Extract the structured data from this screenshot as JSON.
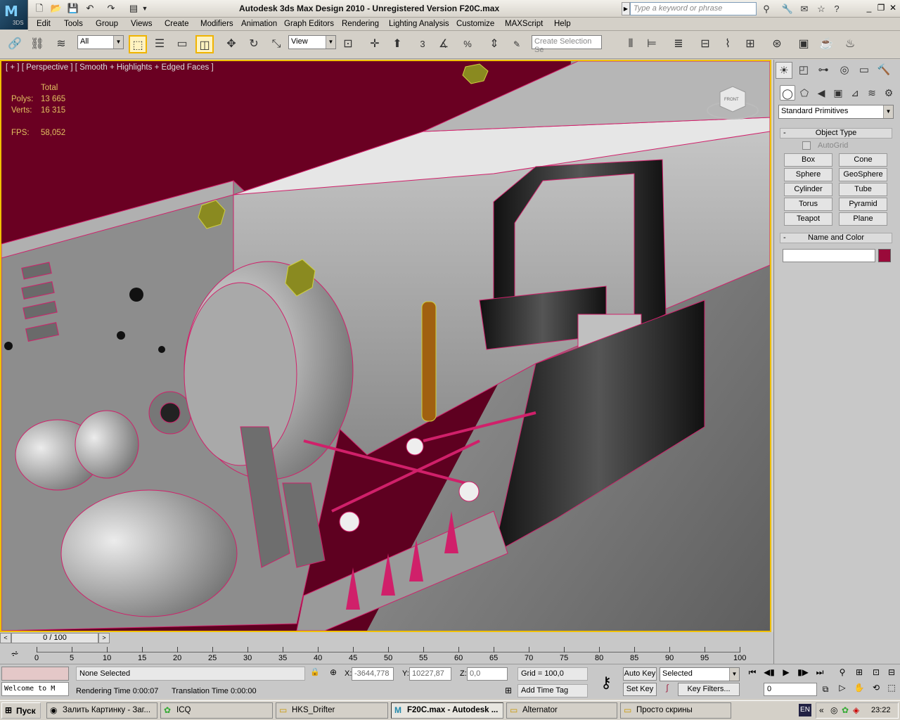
{
  "app": {
    "logo_text": "M",
    "logo_sub": "3DS",
    "title": "Autodesk 3ds Max Design 2010  - Unregistered Version     F20C.max",
    "search_placeholder": "Type a keyword or phrase"
  },
  "menu": [
    "Edit",
    "Tools",
    "Group",
    "Views",
    "Create",
    "Modifiers",
    "Animation",
    "Graph Editors",
    "Rendering",
    "Lighting Analysis",
    "Customize",
    "MAXScript",
    "Help"
  ],
  "toolbar": {
    "selection_filter": "All",
    "reference_coord": "View",
    "named_selection_placeholder": "Create Selection Se",
    "snap_label": "3",
    "angle_snap_label": "%"
  },
  "viewport": {
    "label": "[ + ] [ Perspective ] [ Smooth + Highlights + Edged Faces ]",
    "stats": {
      "total_label": "Total",
      "polys_label": "Polys:",
      "polys_value": "13 665",
      "verts_label": "Verts:",
      "verts_value": "16 315",
      "fps_label": "FPS:",
      "fps_value": "58,052"
    },
    "viewcube_label": "FRONT"
  },
  "command_panel": {
    "category": "Standard Primitives",
    "object_type_title": "Object Type",
    "autogrid_label": "AutoGrid",
    "primitives": [
      "Box",
      "Cone",
      "Sphere",
      "GeoSphere",
      "Cylinder",
      "Tube",
      "Torus",
      "Pyramid",
      "Teapot",
      "Plane"
    ],
    "name_color_title": "Name and Color",
    "object_color": "#9a0a3a"
  },
  "timeline": {
    "frame_display": "0 / 100",
    "ticks": [
      "0",
      "5",
      "10",
      "15",
      "20",
      "25",
      "30",
      "35",
      "40",
      "45",
      "50",
      "55",
      "60",
      "65",
      "70",
      "75",
      "80",
      "85",
      "90",
      "95",
      "100"
    ]
  },
  "status": {
    "maxscript_text": "Welcome to M",
    "selection": "None Selected",
    "rendering_time": "Rendering Time  0:00:07",
    "translation_time": "Translation Time  0:00:00",
    "x_label": "X:",
    "x_value": "-3644,778",
    "y_label": "Y:",
    "y_value": "10227,87",
    "z_label": "Z:",
    "z_value": "0,0",
    "grid": "Grid = 100,0",
    "add_time_tag": "Add Time Tag",
    "auto_key": "Auto Key",
    "set_key": "Set Key",
    "key_mode": "Selected",
    "key_filters": "Key Filters...",
    "current_frame": "0"
  },
  "taskbar": {
    "start": "Пуск",
    "tasks": [
      {
        "label": "Залить Картинку - Заг...",
        "active": false
      },
      {
        "label": "ICQ",
        "active": false
      },
      {
        "label": "HKS_Drifter",
        "active": false
      },
      {
        "label": "F20C.max - Autodesk ...",
        "active": true
      },
      {
        "label": "Alternator",
        "active": false
      },
      {
        "label": "Просто скрины",
        "active": false
      }
    ],
    "lang": "EN",
    "clock": "23:22"
  },
  "colors": {
    "viewport_border": "#f0c000",
    "background_red": "#6a0022",
    "wire": "#d0206a"
  }
}
